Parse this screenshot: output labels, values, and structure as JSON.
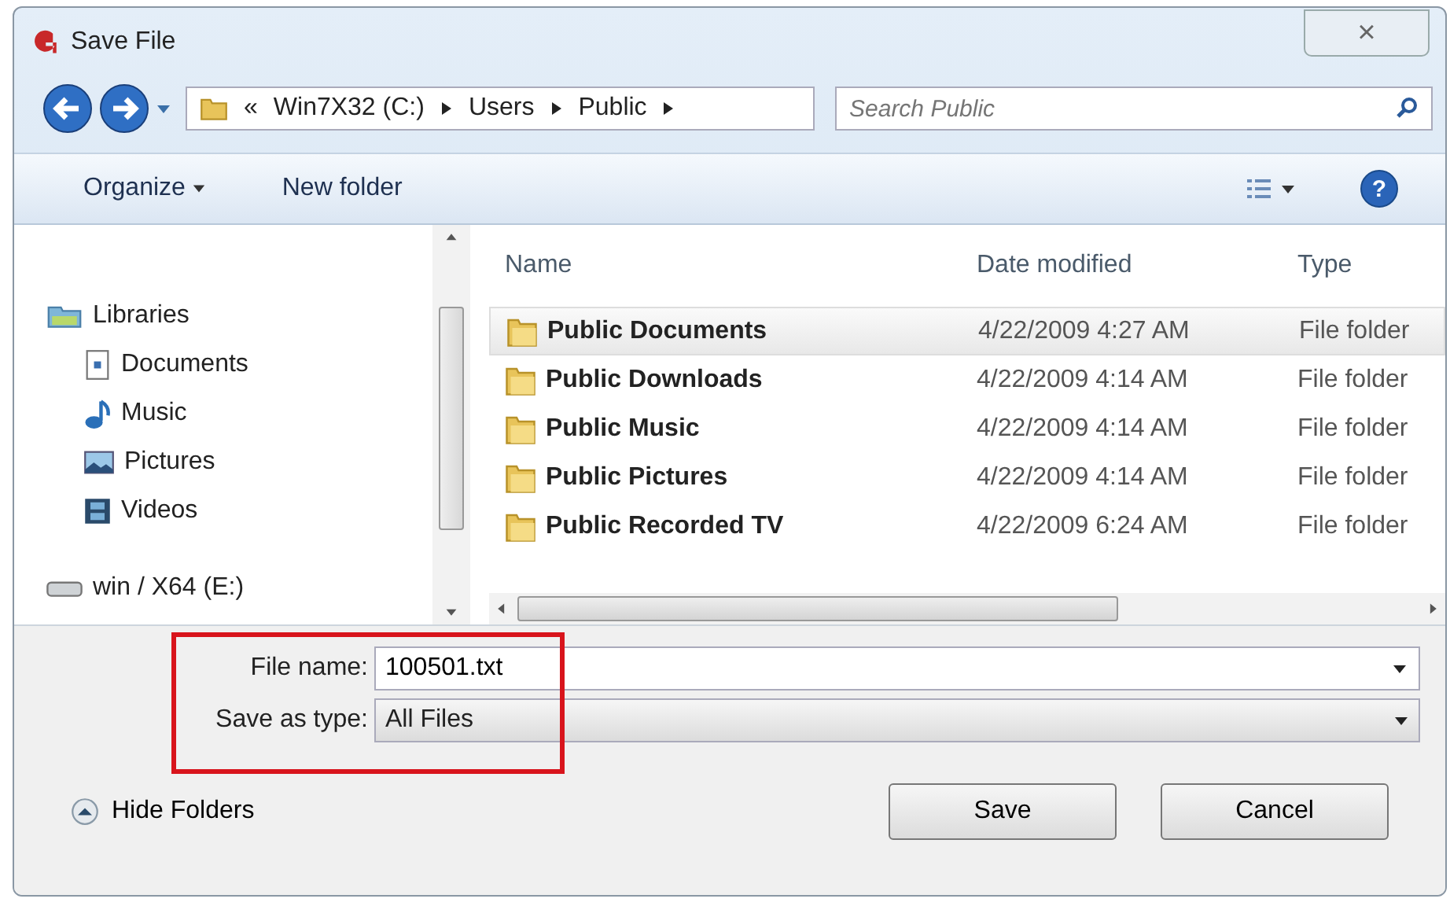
{
  "window": {
    "title": "Save File",
    "close": "×"
  },
  "address": {
    "overflow": "«",
    "crumbs": [
      "Win7X32 (C:)",
      "Users",
      "Public"
    ]
  },
  "search": {
    "placeholder": "Search Public"
  },
  "toolbar": {
    "organize": "Organize",
    "new_folder": "New folder",
    "help": "?"
  },
  "sidebar": {
    "items": [
      {
        "label": "Libraries",
        "kind": "library",
        "children": [
          {
            "label": "Documents",
            "kind": "documents"
          },
          {
            "label": "Music",
            "kind": "music"
          },
          {
            "label": "Pictures",
            "kind": "pictures"
          },
          {
            "label": "Videos",
            "kind": "videos"
          }
        ]
      },
      {
        "label": "win / X64 (E:)",
        "kind": "drive"
      }
    ]
  },
  "table": {
    "columns": [
      "Name",
      "Date modified",
      "Type"
    ],
    "rows": [
      {
        "name": "Public Documents",
        "date": "4/22/2009 4:27 AM",
        "type": "File folder",
        "selected": true
      },
      {
        "name": "Public Downloads",
        "date": "4/22/2009 4:14 AM",
        "type": "File folder",
        "selected": false
      },
      {
        "name": "Public Music",
        "date": "4/22/2009 4:14 AM",
        "type": "File folder",
        "selected": false
      },
      {
        "name": "Public Pictures",
        "date": "4/22/2009 4:14 AM",
        "type": "File folder",
        "selected": false
      },
      {
        "name": "Public Recorded TV",
        "date": "4/22/2009 6:24 AM",
        "type": "File folder",
        "selected": false
      }
    ]
  },
  "form": {
    "file_name_label": "File name:",
    "file_name": "100501.txt",
    "type_label": "Save as type:",
    "type_value": "All Files"
  },
  "footer": {
    "hide_folders": "Hide Folders",
    "buttons": [
      "Save",
      "Cancel"
    ]
  }
}
